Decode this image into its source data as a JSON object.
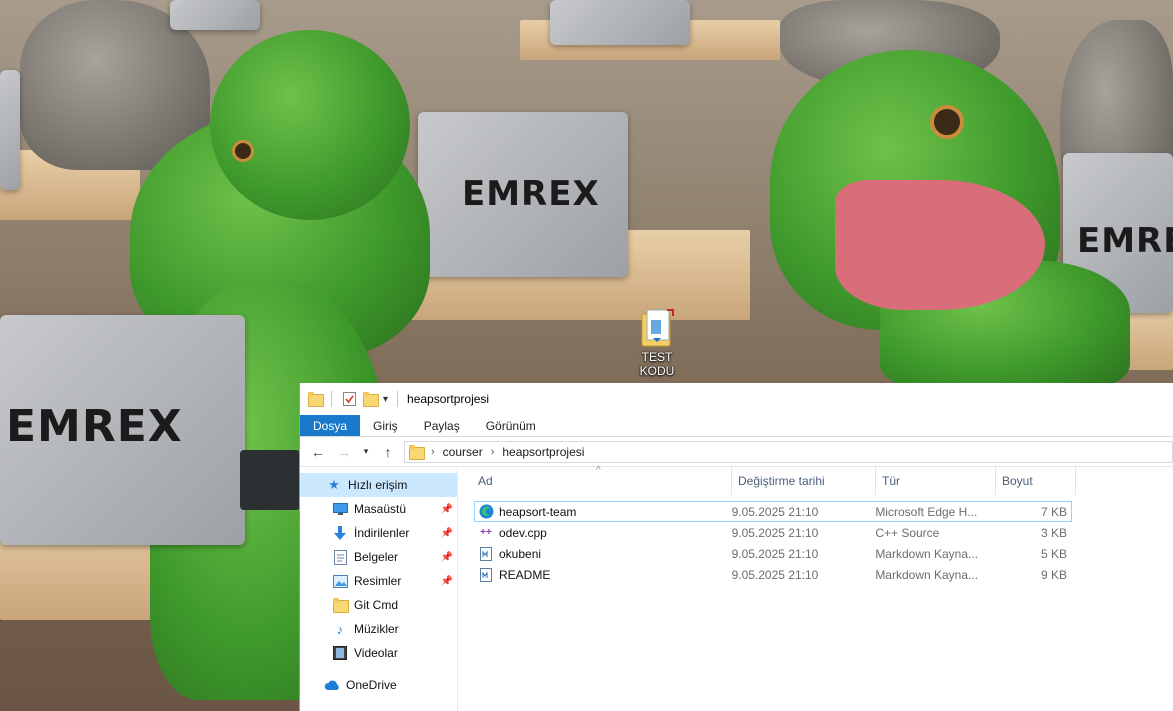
{
  "desktop": {
    "icon_label": "TEST KODU",
    "wallpaper_text": [
      "EMREX",
      "EMREX",
      "EMREX"
    ]
  },
  "window": {
    "title": "heapsortprojesi"
  },
  "ribbon": {
    "tabs": [
      "Dosya",
      "Giriş",
      "Paylaş",
      "Görünüm"
    ],
    "active_tab": "Dosya"
  },
  "address": {
    "crumbs": [
      "courser",
      "heapsortprojesi"
    ]
  },
  "navpane": {
    "items": [
      {
        "label": "Hızlı erişim",
        "icon": "star-icon",
        "pinned": false,
        "selected": true
      },
      {
        "label": "Masaüstü",
        "icon": "desktop-icon",
        "pinned": true
      },
      {
        "label": "İndirilenler",
        "icon": "download-icon",
        "pinned": true
      },
      {
        "label": "Belgeler",
        "icon": "document-icon",
        "pinned": true
      },
      {
        "label": "Resimler",
        "icon": "pictures-icon",
        "pinned": true
      },
      {
        "label": "Git Cmd",
        "icon": "folder-icon",
        "pinned": false
      },
      {
        "label": "Müzikler",
        "icon": "music-icon",
        "pinned": false
      },
      {
        "label": "Videolar",
        "icon": "video-icon",
        "pinned": false
      },
      {
        "label": "OneDrive",
        "icon": "cloud-icon",
        "pinned": false
      }
    ]
  },
  "columns": {
    "name": "Ad",
    "modified": "Değiştirme tarihi",
    "type": "Tür",
    "size": "Boyut"
  },
  "files": [
    {
      "name": "heapsort-team",
      "modified": "9.05.2025 21:10",
      "type": "Microsoft Edge H...",
      "size": "7 KB",
      "icon": "edge-icon"
    },
    {
      "name": "odev.cpp",
      "modified": "9.05.2025 21:10",
      "type": "C++ Source",
      "size": "3 KB",
      "icon": "cpp-file-icon"
    },
    {
      "name": "okubeni",
      "modified": "9.05.2025 21:10",
      "type": "Markdown Kayna...",
      "size": "5 KB",
      "icon": "markdown-file-icon"
    },
    {
      "name": "README",
      "modified": "9.05.2025 21:10",
      "type": "Markdown Kayna...",
      "size": "9 KB",
      "icon": "markdown-file-icon"
    }
  ],
  "colors": {
    "accent": "#1979ca",
    "selection": "#cce8ff",
    "focus_border": "#99d1ff"
  }
}
